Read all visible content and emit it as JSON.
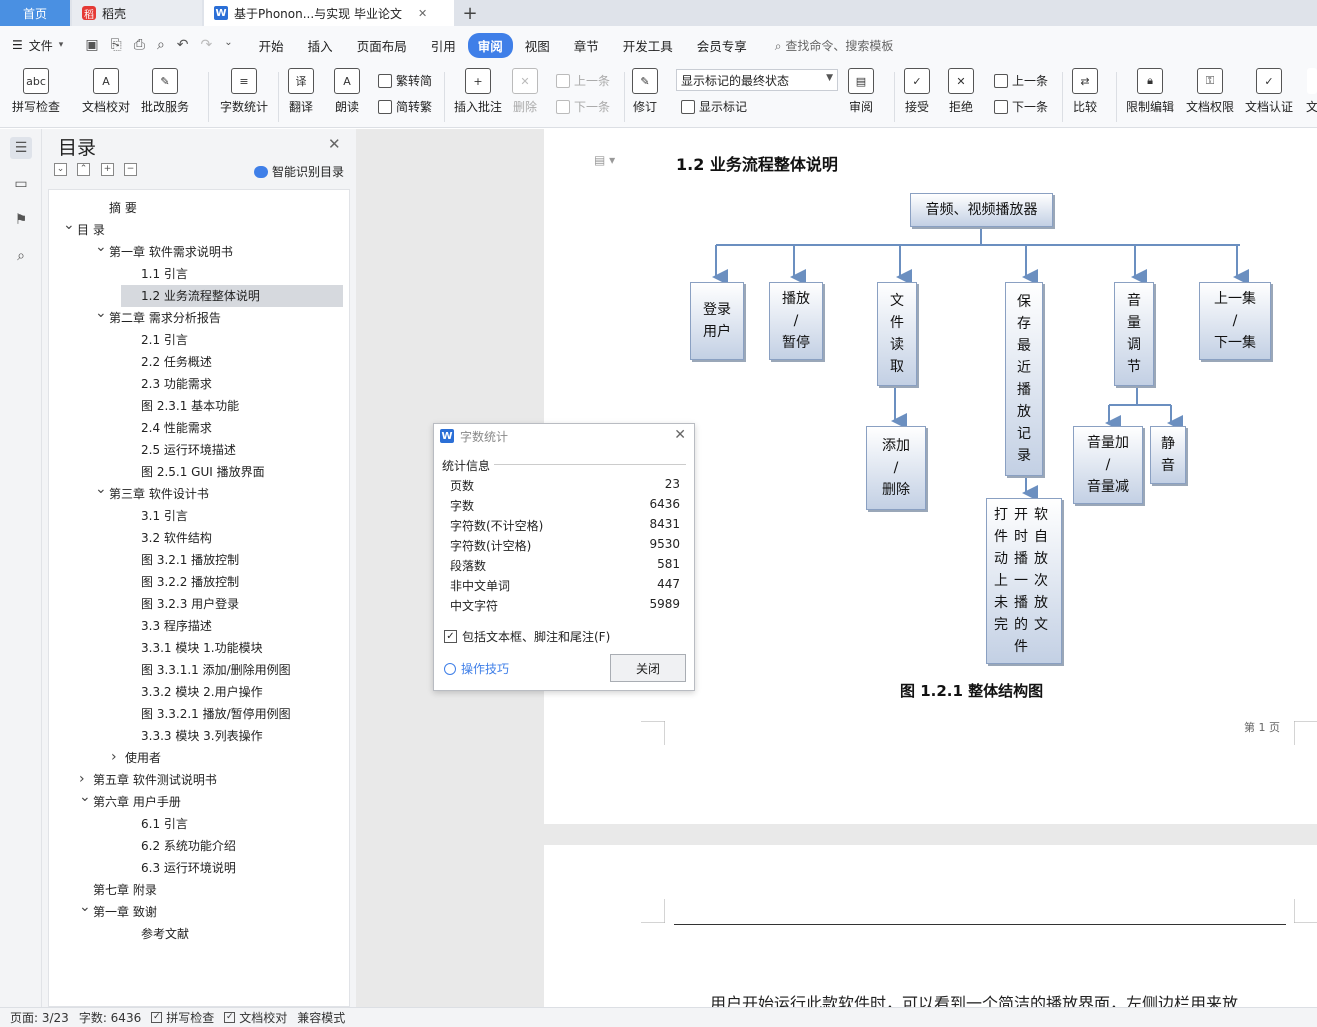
{
  "tabs": {
    "home": "首页",
    "daoke": "稻壳",
    "doc": "基于Phonon...与实现 毕业论文"
  },
  "menu": {
    "file": "文件",
    "items": [
      "开始",
      "插入",
      "页面布局",
      "引用",
      "审阅",
      "视图",
      "章节",
      "开发工具",
      "会员专享"
    ],
    "active": "审阅",
    "search": "查找命令、搜索模板"
  },
  "ribbon": {
    "spell": "拼写检查",
    "doc_check": "文档校对",
    "batch": "批改服务",
    "word_count": "字数统计",
    "translate": "翻译",
    "read": "朗读",
    "trad": "繁转简",
    "simp": "简转繁",
    "insert_comment": "插入批注",
    "delete": "删除",
    "prev": "上一条",
    "next": "下一条",
    "revise": "修订",
    "markup_mode": "显示标记的最终状态",
    "show_markup": "显示标记",
    "review": "审阅",
    "accept": "接受",
    "reject": "拒绝",
    "prev2": "上一条",
    "next2": "下一条",
    "compare": "比较",
    "restrict": "限制编辑",
    "rights": "文档权限",
    "auth": "文档认证",
    "more": "文"
  },
  "nav": {
    "title": "目录",
    "smart": "智能识别目录",
    "items": [
      {
        "text": "摘  要",
        "indent": 0,
        "chev": ""
      },
      {
        "text": "目 录",
        "indent": 0,
        "chev": "down"
      },
      {
        "text": "第一章  软件需求说明书",
        "indent": 1,
        "chev": "down"
      },
      {
        "text": "1.1 引言",
        "indent": 2,
        "chev": ""
      },
      {
        "text": "1.2 业务流程整体说明",
        "indent": 2,
        "chev": "",
        "selected": true
      },
      {
        "text": "第二章  需求分析报告",
        "indent": 1,
        "chev": "down"
      },
      {
        "text": "2.1 引言",
        "indent": 2,
        "chev": ""
      },
      {
        "text": "2.2 任务概述",
        "indent": 2,
        "chev": ""
      },
      {
        "text": "2.3 功能需求",
        "indent": 2,
        "chev": ""
      },
      {
        "text": "图 2.3.1  基本功能",
        "indent": 2,
        "chev": ""
      },
      {
        "text": "2.4 性能需求",
        "indent": 2,
        "chev": ""
      },
      {
        "text": "2.5 运行环境描述",
        "indent": 2,
        "chev": ""
      },
      {
        "text": "图 2.5.1  GUI 播放界面",
        "indent": 2,
        "chev": ""
      },
      {
        "text": "第三章  软件设计书",
        "indent": 1,
        "chev": "down"
      },
      {
        "text": "3.1 引言",
        "indent": 2,
        "chev": ""
      },
      {
        "text": "3.2 软件结构",
        "indent": 2,
        "chev": ""
      },
      {
        "text": "图 3.2.1  播放控制",
        "indent": 2,
        "chev": ""
      },
      {
        "text": "图 3.2.2  播放控制",
        "indent": 2,
        "chev": ""
      },
      {
        "text": "图 3.2.3   用户登录",
        "indent": 2,
        "chev": ""
      },
      {
        "text": "3.3 程序描述",
        "indent": 2,
        "chev": ""
      },
      {
        "text": "3.3.1 模块 1.功能模块",
        "indent": 2,
        "chev": ""
      },
      {
        "text": "图 3.3.1.1  添加/删除用例图",
        "indent": 2,
        "chev": ""
      },
      {
        "text": "3.3.2 模块 2.用户操作",
        "indent": 2,
        "chev": ""
      },
      {
        "text": "图 3.3.2.1  播放/暂停用例图",
        "indent": 2,
        "chev": ""
      },
      {
        "text": "3.3.3 模块 3.列表操作",
        "indent": 2,
        "chev": ""
      },
      {
        "text": "使用者",
        "indent": 3,
        "chev": "right"
      },
      {
        "text": "第五章  软件测试说明书",
        "indent": 4,
        "chev": "right"
      },
      {
        "text": "第六章  用户手册",
        "indent": 4,
        "chev": "down"
      },
      {
        "text": "6.1 引言",
        "indent": 2,
        "chev": ""
      },
      {
        "text": "6.2 系统功能介绍",
        "indent": 2,
        "chev": ""
      },
      {
        "text": "6.3 运行环境说明",
        "indent": 2,
        "chev": ""
      },
      {
        "text": "第七章  附录",
        "indent": 4,
        "chev": ""
      },
      {
        "text": "第一章  致谢",
        "indent": 4,
        "chev": "down"
      },
      {
        "text": "参考文献",
        "indent": 2,
        "chev": ""
      }
    ]
  },
  "doc": {
    "section_title": "1.2 业务流程整体说明",
    "flow": {
      "root": "音频、视频播放器",
      "login": "登录\n用户",
      "play": "播放\n/\n暂停",
      "file": "文\n件\n读\n取",
      "save": "保\n存\n最\n近\n播\n放\n记\n录",
      "volume": "音\n量\n调\n节",
      "episode": "上一集\n/\n下一集",
      "add": "添加\n/\n删除",
      "vol_up": "音量加\n/\n音量减",
      "mute": "静\n音",
      "resume": "打开软\n件时自\n动播放\n上一次\n未播放\n完的文\n件"
    },
    "caption": "图 1.2.1    整体结构图",
    "page_number": "第 1 页",
    "body": "用户开始运行此款软件时，可以看到一个简洁的播放界面，左侧边栏用来放"
  },
  "dialog": {
    "title": "字数统计",
    "group": "统计信息",
    "stats": [
      {
        "label": "页数",
        "value": "23"
      },
      {
        "label": "字数",
        "value": "6436"
      },
      {
        "label": "字符数(不计空格)",
        "value": "8431"
      },
      {
        "label": "字符数(计空格)",
        "value": "9530"
      },
      {
        "label": "段落数",
        "value": "581"
      },
      {
        "label": "非中文单词",
        "value": "447"
      },
      {
        "label": "中文字符",
        "value": "5989"
      }
    ],
    "include_label": "包括文本框、脚注和尾注(F)",
    "include_checked": true,
    "tips": "操作技巧",
    "close": "关闭"
  },
  "status": {
    "page": "页面: 3/23",
    "words": "字数: 6436",
    "spell": "拼写检查",
    "proof": "文档校对",
    "compat": "兼容模式"
  },
  "colors": {
    "accent": "#3f7fe8",
    "flow_line": "#6b8fc0"
  }
}
